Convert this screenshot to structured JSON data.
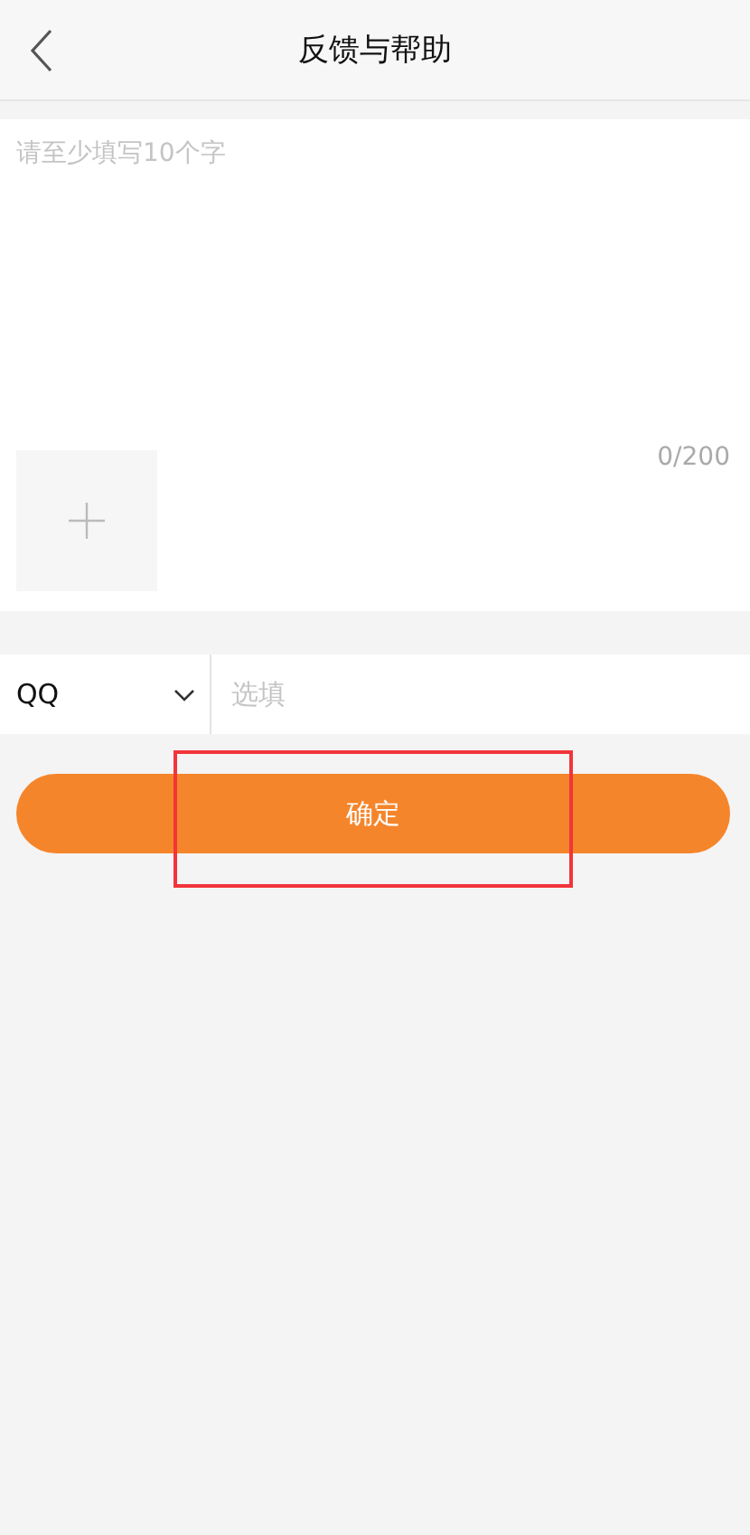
{
  "header": {
    "title": "反馈与帮助"
  },
  "feedback": {
    "placeholder": "请至少填写10个字",
    "counter": "0/200"
  },
  "contact": {
    "type": "QQ",
    "placeholder": "选填"
  },
  "submit": {
    "label": "确定",
    "highlighted": true
  }
}
